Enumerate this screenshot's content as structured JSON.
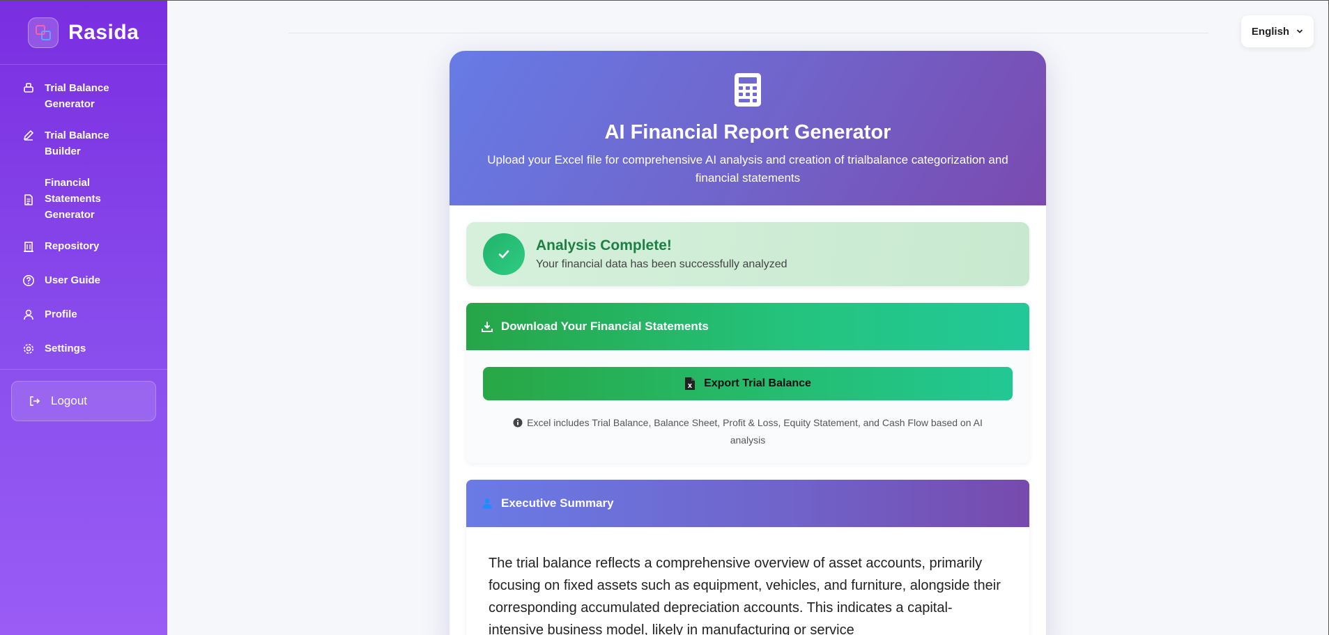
{
  "brand": {
    "name": "Rasida"
  },
  "sidebar": {
    "items": [
      {
        "label": "Trial Balance Generator",
        "icon": "stack-icon"
      },
      {
        "label": "Trial Balance Builder",
        "icon": "pencil-icon"
      },
      {
        "label": "Financial Statements Generator",
        "icon": "document-icon"
      },
      {
        "label": "Repository",
        "icon": "building-icon"
      },
      {
        "label": "User Guide",
        "icon": "help-circle-icon"
      },
      {
        "label": "Profile",
        "icon": "user-icon"
      },
      {
        "label": "Settings",
        "icon": "gear-icon"
      }
    ],
    "logout_label": "Logout"
  },
  "language": {
    "selected": "English"
  },
  "hero": {
    "title": "AI Financial Report Generator",
    "subtitle": "Upload your Excel file for comprehensive AI analysis and creation of trialbalance categorization and financial statements"
  },
  "status": {
    "title": "Analysis Complete!",
    "message": "Your financial data has been successfully analyzed"
  },
  "download": {
    "heading": "Download Your Financial Statements",
    "export_label": "Export Trial Balance",
    "note": "Excel includes Trial Balance, Balance Sheet, Profit & Loss, Equity Statement, and Cash Flow based on AI analysis"
  },
  "summary": {
    "heading": "Executive Summary",
    "text": "The trial balance reflects a comprehensive overview of asset accounts, primarily focusing on fixed assets such as equipment, vehicles, and furniture, alongside their corresponding accumulated depreciation accounts. This indicates a capital-intensive business model, likely in manufacturing or service"
  },
  "colors": {
    "sidebar": "#7a2ee0",
    "hero_start": "#677be6",
    "hero_end": "#7a4ab0",
    "success_green": "#1d7f43",
    "button_green": "#28a745"
  }
}
